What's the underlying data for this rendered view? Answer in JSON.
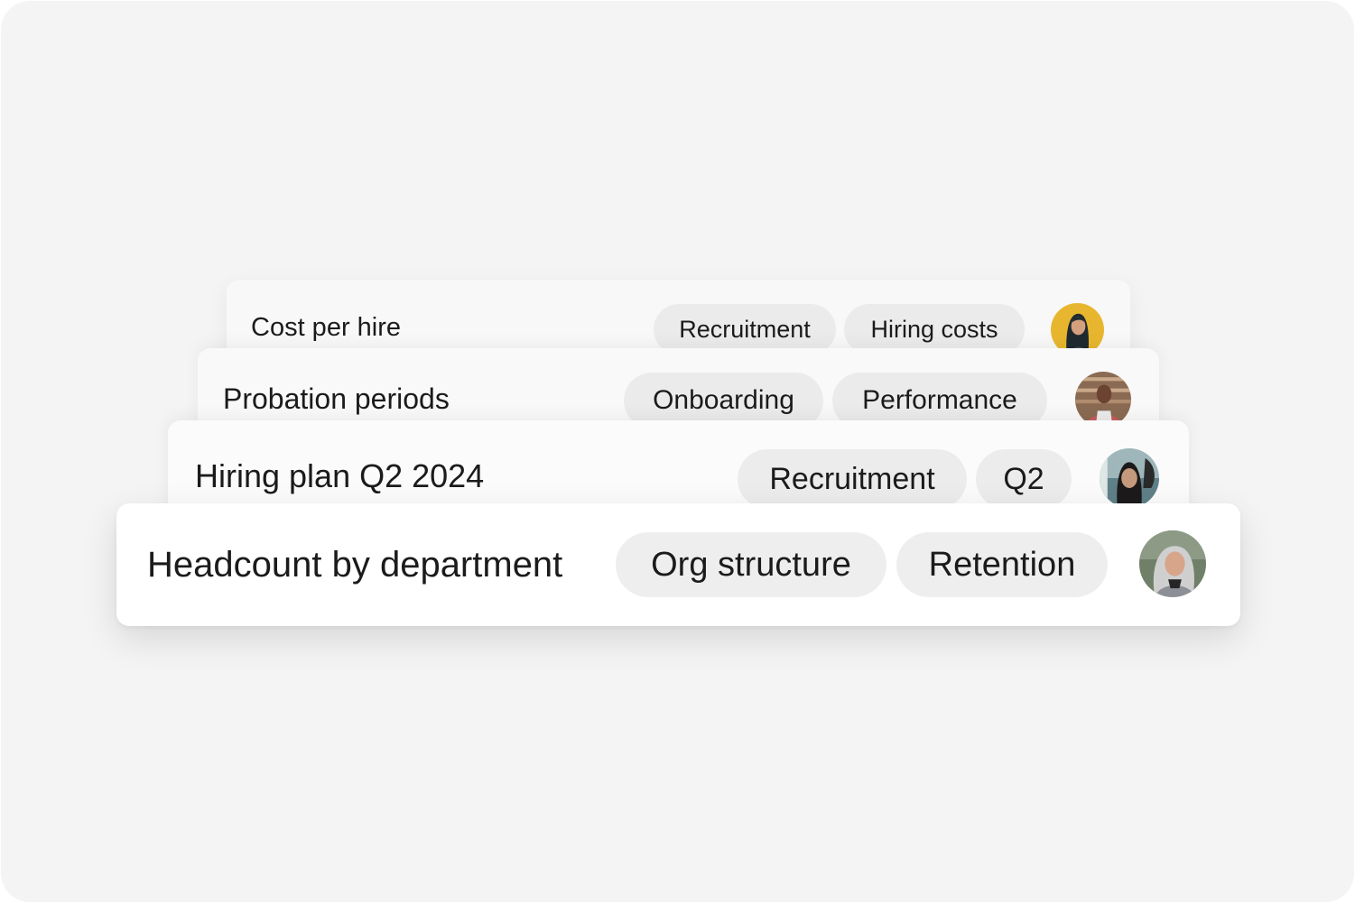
{
  "cards": [
    {
      "title": "Cost per hire",
      "tags": [
        "Recruitment",
        "Hiring costs"
      ],
      "avatar": {
        "description": "woman with dark hair on yellow background",
        "bg": "#e8b62e"
      }
    },
    {
      "title": "Probation periods",
      "tags": [
        "Onboarding",
        "Performance"
      ],
      "avatar": {
        "description": "smiling man in apron in a workshop",
        "bg": "#8a6a52"
      }
    },
    {
      "title": "Hiring plan Q2 2024",
      "tags": [
        "Recruitment",
        "Q2"
      ],
      "avatar": {
        "description": "woman with long dark hair by the sea",
        "bg": "#9fb7bb"
      }
    },
    {
      "title": "Headcount by department",
      "tags": [
        "Org structure",
        "Retention"
      ],
      "avatar": {
        "description": "smiling woman with grey hair outdoors",
        "bg": "#6f7f68"
      }
    }
  ],
  "colors": {
    "background": "#f4f4f4",
    "card": "#ffffff",
    "chip": "#ededed",
    "text": "#1b1b1b"
  }
}
